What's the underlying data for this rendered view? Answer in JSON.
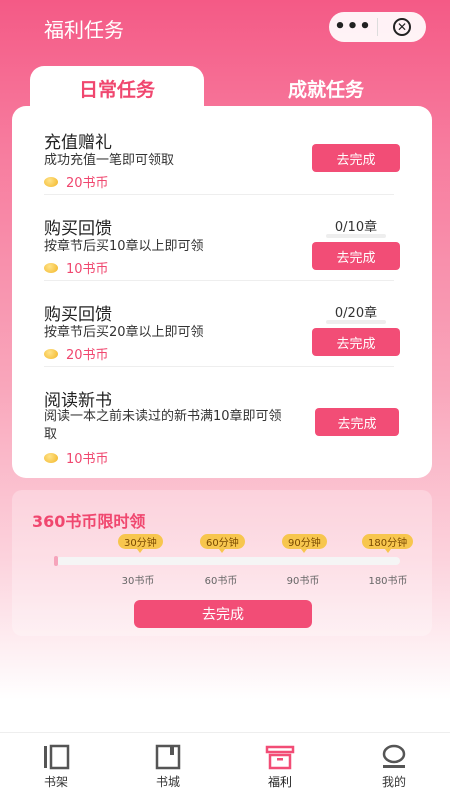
{
  "header": {
    "title": "福利任务",
    "capsule": {
      "more_icon": "more-dots-icon",
      "close_icon": "close-circle-icon"
    }
  },
  "tabs": [
    {
      "label": "日常任务",
      "active": true
    },
    {
      "label": "成就任务",
      "active": false
    }
  ],
  "tasks": [
    {
      "title": "充值赠礼",
      "desc": "成功充值一笔即可领取",
      "reward": "20书币",
      "button": "去完成"
    },
    {
      "title": "购买回馈",
      "desc": "按章节后买10章以上即可领",
      "progress": "0/10章",
      "reward": "10书币",
      "button": "去完成"
    },
    {
      "title": "购买回馈",
      "desc": "按章节后买20章以上即可领",
      "progress": "0/20章",
      "reward": "20书币",
      "button": "去完成"
    },
    {
      "title": "阅读新书",
      "desc_line1": "阅读一本之前未读过的新书满10章即可领",
      "desc_line2": "取",
      "reward": "10书币",
      "button": "去完成"
    }
  ],
  "bonus": {
    "title": "360书币限时领",
    "milestones": [
      {
        "time": "30分钟",
        "coins": "30书币"
      },
      {
        "time": "60分钟",
        "coins": "60书币"
      },
      {
        "time": "90分钟",
        "coins": "90书币"
      },
      {
        "time": "180分钟",
        "coins": "180书币"
      }
    ],
    "progress": 0,
    "button": "去完成"
  },
  "tabbar": [
    {
      "label": "书架",
      "icon": "bookshelf-icon",
      "active": false
    },
    {
      "label": "书城",
      "icon": "bookstore-icon",
      "active": false
    },
    {
      "label": "福利",
      "icon": "gift-icon",
      "active": true
    },
    {
      "label": "我的",
      "icon": "profile-icon",
      "active": false
    }
  ],
  "colors": {
    "accent": "#f24d76",
    "tab_active_text": "#f0476f",
    "coin": "#f2b526"
  }
}
